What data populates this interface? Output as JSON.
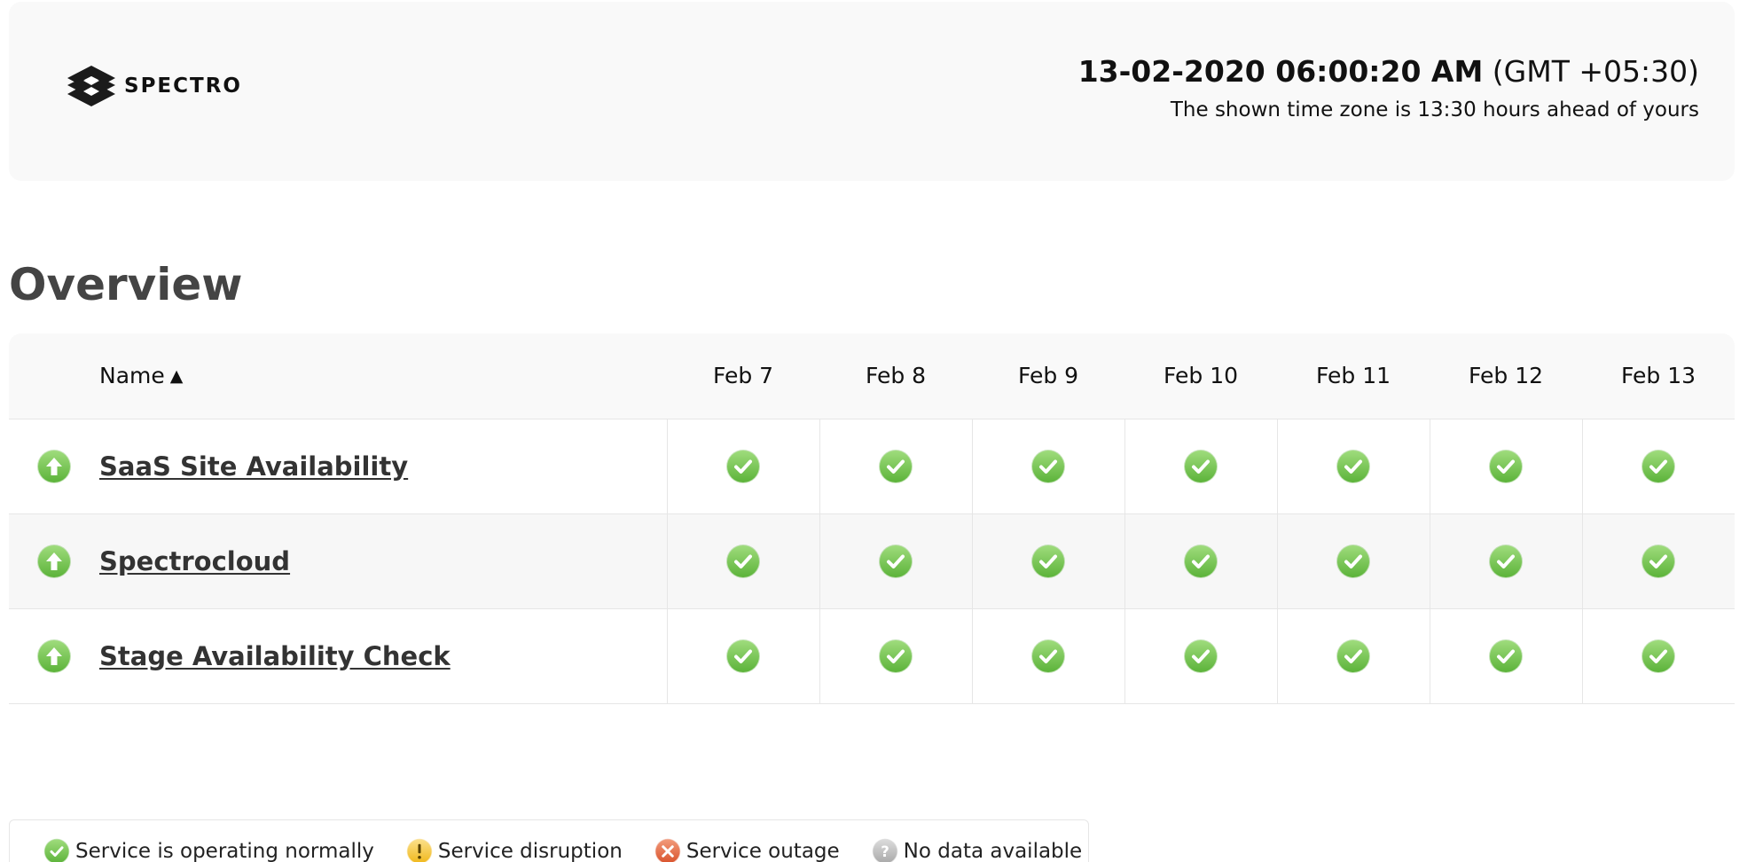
{
  "header": {
    "logo_text": "SPECTRO",
    "timestamp": "13-02-2020 06:00:20 AM",
    "timezone": "(GMT +05:30)",
    "timezone_note": "The shown time zone is 13:30 hours ahead of yours"
  },
  "overview": {
    "title": "Overview"
  },
  "table": {
    "name_header": "Name",
    "sort_indicator": "▲",
    "days": [
      "Feb 7",
      "Feb 8",
      "Feb 9",
      "Feb 10",
      "Feb 11",
      "Feb 12",
      "Feb 13"
    ],
    "rows": [
      {
        "name": "SaaS Site Availability",
        "current_status": "up",
        "daily": [
          "operational",
          "operational",
          "operational",
          "operational",
          "operational",
          "operational",
          "operational"
        ]
      },
      {
        "name": "Spectrocloud",
        "current_status": "up",
        "daily": [
          "operational",
          "operational",
          "operational",
          "operational",
          "operational",
          "operational",
          "operational"
        ]
      },
      {
        "name": "Stage Availability Check",
        "current_status": "up",
        "daily": [
          "operational",
          "operational",
          "operational",
          "operational",
          "operational",
          "operational",
          "operational"
        ]
      }
    ]
  },
  "legend": {
    "items": [
      {
        "status": "operational",
        "icon": "check-circle-icon",
        "label": "Service is operating normally"
      },
      {
        "status": "disruption",
        "icon": "exclamation-circle-icon",
        "label": "Service disruption"
      },
      {
        "status": "outage",
        "icon": "x-circle-icon",
        "label": "Service outage"
      },
      {
        "status": "nodata",
        "icon": "question-circle-icon",
        "label": "No data available"
      }
    ]
  },
  "colors": {
    "operational": "#5cb33a",
    "disruption": "#f0b81c",
    "outage": "#d9532c",
    "nodata": "#a9a9a9",
    "heading": "#444444"
  }
}
